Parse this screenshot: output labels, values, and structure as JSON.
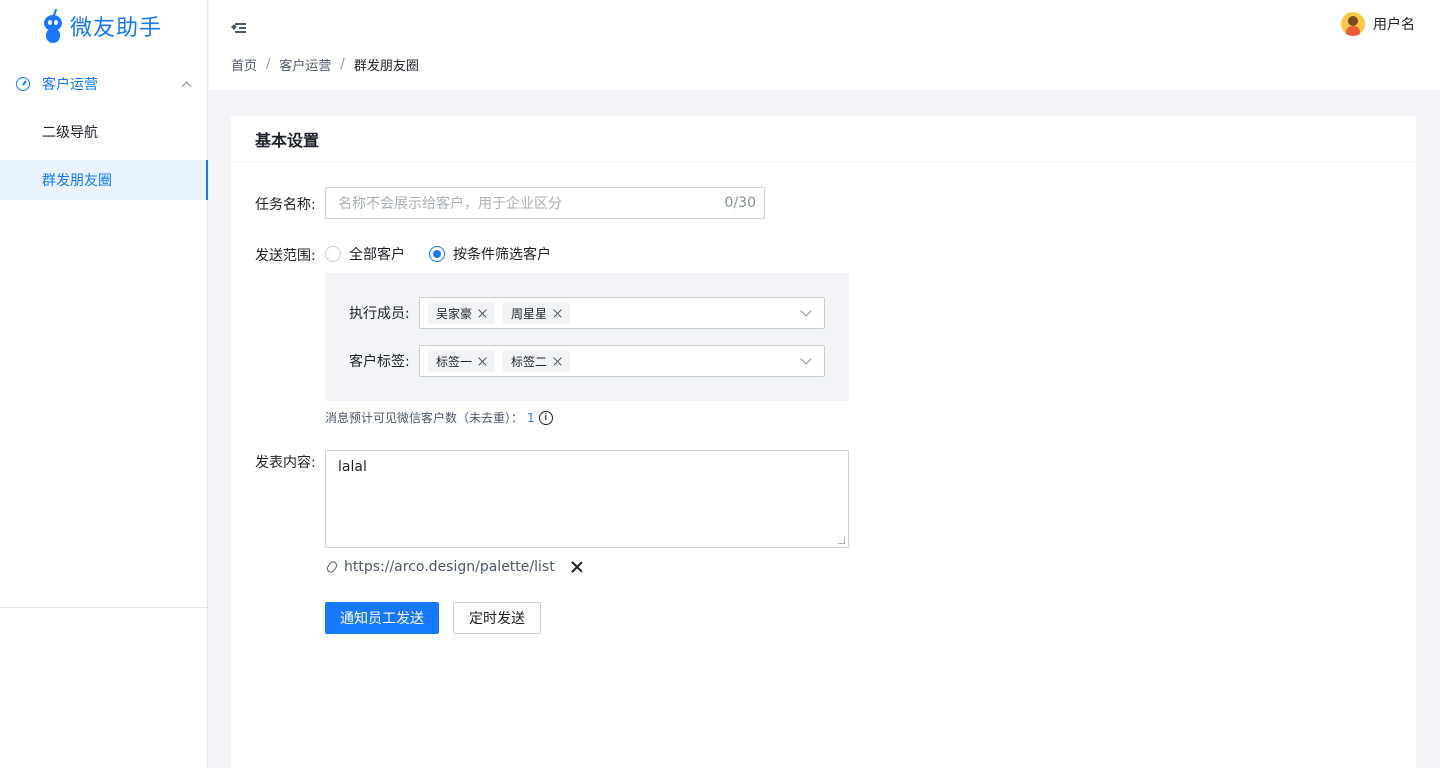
{
  "app": {
    "name": "微友助手"
  },
  "sidebar": {
    "group": {
      "label": "客户运营"
    },
    "items": [
      {
        "label": "二级导航"
      },
      {
        "label": "群发朋友圈"
      }
    ]
  },
  "header": {
    "breadcrumb": [
      "首页",
      "客户运营",
      "群发朋友圈"
    ],
    "user_name": "用户名"
  },
  "card": {
    "title": "基本设置"
  },
  "form": {
    "task_name": {
      "label": "任务名称:",
      "placeholder": "名称不会展示给客户，用于企业区分",
      "counter": "0/30"
    },
    "scope": {
      "label": "发送范围:",
      "options": [
        "全部客户",
        "按条件筛选客户"
      ],
      "selected": "按条件筛选客户"
    },
    "members": {
      "label": "执行成员:",
      "tags": [
        "吴家豪",
        "周星星"
      ]
    },
    "customer_tags": {
      "label": "客户标签:",
      "tags": [
        "标签一",
        "标签二"
      ]
    },
    "hint": {
      "text": "消息预计可见微信客户数（未去重）：",
      "count": "1"
    },
    "content": {
      "label": "发表内容:",
      "value": "lalal"
    },
    "attachment": {
      "url": "https://arco.design/palette/list"
    },
    "buttons": {
      "notify": "通知员工发送",
      "schedule": "定时发送"
    }
  },
  "colors": {
    "primary": "#1677ff",
    "background": "#f2f4f7"
  }
}
